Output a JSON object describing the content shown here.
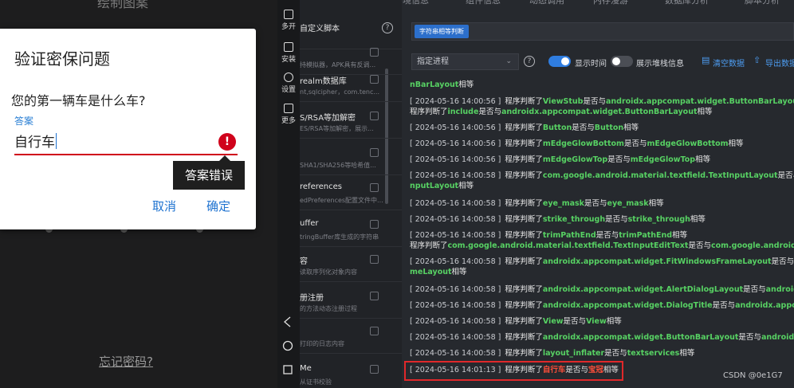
{
  "phone": {
    "top_text": "绘制图案",
    "forgot_password": "忘记密码?",
    "dialog": {
      "title": "验证密保问题",
      "question": "您的第一辆车是什么车?",
      "answer_label": "答案",
      "answer_value": "自行车",
      "error_tooltip": "答案错误",
      "cancel_label": "取消",
      "ok_label": "确定"
    }
  },
  "emulator": {
    "multi_open": "多开",
    "install": "安装",
    "settings": "设置",
    "more": "更多"
  },
  "scripts": {
    "items": [
      {
        "name": "自定义脚本",
        "desc": ""
      },
      {
        "name": "",
        "desc": "持模拟器，APK具有反调..."
      },
      {
        "name": "realm数据库",
        "desc": "nt,sqlcipher，com.tenc..."
      },
      {
        "name": "S/RSA等加解密",
        "desc": "ES/RSA等加解密，展示..."
      },
      {
        "name": "",
        "desc": "SHA1/SHA256等哈希值..."
      },
      {
        "name": "references",
        "desc": "edPreferences配置文件中..."
      },
      {
        "name": "uffer",
        "desc": "tringBuffer库生成的字符串"
      },
      {
        "name": "容",
        "desc": "读取序列化对象内容"
      },
      {
        "name": "册注册",
        "desc": "的方法动态注册过程"
      },
      {
        "name": "",
        "desc": "打印的日志内容"
      },
      {
        "name": "Me",
        "desc": "从证书校验"
      }
    ]
  },
  "logpanel": {
    "top_tabs": [
      "环境信息",
      "组件信息",
      "动态调用",
      "内存漫游",
      "数据库分析",
      "脚本分析"
    ],
    "filter_tag": "字符串相等判断",
    "process_select": "指定进程",
    "show_time_label": "显示时间",
    "show_time_on": true,
    "show_stack_label": "展示堆栈信息",
    "show_stack_on": false,
    "clear_label": "清空数据",
    "export_label": "导出数据",
    "logs": [
      {
        "ts": "",
        "pre": "",
        "a": "nBarLayout",
        "mid": "相等",
        "b": "",
        "post": ""
      },
      {
        "ts": "[ 2024-05-16 14:00:56 ]",
        "pre": "程序判断了",
        "a": "ViewStub",
        "mid": "是否与",
        "b": "androidx.appcompat.widget.ButtonBarLayout",
        "post": "相等"
      },
      {
        "ts": "",
        "pre": "程序判断了",
        "a": "include",
        "mid": "是否与",
        "b": "androidx.appcompat.widget.ButtonBarLayout",
        "post": "相等"
      },
      {
        "ts": "[ 2024-05-16 14:00:56 ]",
        "pre": "程序判断了",
        "a": "Button",
        "mid": "是否与",
        "b": "Button",
        "post": "相等"
      },
      {
        "ts": "[ 2024-05-16 14:00:56 ]",
        "pre": "程序判断了",
        "a": "mEdgeGlowBottom",
        "mid": "是否与",
        "b": "mEdgeGlowBottom",
        "post": "相等"
      },
      {
        "ts": "[ 2024-05-16 14:00:56 ]",
        "pre": "程序判断了",
        "a": "mEdgeGlowTop",
        "mid": "是否与",
        "b": "mEdgeGlowTop",
        "post": "相等"
      },
      {
        "ts": "[ 2024-05-16 14:00:58 ]",
        "pre": "程序判断了",
        "a": "com.google.android.material.textfield.TextInputLayout",
        "mid": "是否与",
        "b": "com.",
        "post": ""
      },
      {
        "ts": "",
        "pre": "",
        "a": "nputLayout",
        "mid": "相等",
        "b": "",
        "post": ""
      },
      {
        "ts": "[ 2024-05-16 14:00:58 ]",
        "pre": "程序判断了",
        "a": "eye_mask",
        "mid": "是否与",
        "b": "eye_mask",
        "post": "相等"
      },
      {
        "ts": "[ 2024-05-16 14:00:58 ]",
        "pre": "程序判断了",
        "a": "strike_through",
        "mid": "是否与",
        "b": "strike_through",
        "post": "相等"
      },
      {
        "ts": "[ 2024-05-16 14:00:58 ]",
        "pre": "程序判断了",
        "a": "trimPathEnd",
        "mid": "是否与",
        "b": "trimPathEnd",
        "post": "相等"
      },
      {
        "ts": "",
        "pre": "程序判断了",
        "a": "com.google.android.material.textfield.TextInputEditText",
        "mid": "是否与",
        "b": "com.google.android.mater",
        "post": ""
      },
      {
        "ts": "[ 2024-05-16 14:00:58 ]",
        "pre": "程序判断了",
        "a": "androidx.appcompat.widget.FitWindowsFrameLayout",
        "mid": "是否与",
        "b": "androi",
        "post": ""
      },
      {
        "ts": "",
        "pre": "",
        "a": "meLayout",
        "mid": "相等",
        "b": "",
        "post": ""
      },
      {
        "ts": "[ 2024-05-16 14:00:58 ]",
        "pre": "程序判断了",
        "a": "androidx.appcompat.widget.AlertDialogLayout",
        "mid": "是否与",
        "b": "androidx.app",
        "post": ""
      },
      {
        "ts": "[ 2024-05-16 14:00:58 ]",
        "pre": "程序判断了",
        "a": "androidx.appcompat.widget.DialogTitle",
        "mid": "是否与",
        "b": "androidx.appcompa",
        "post": ""
      },
      {
        "ts": "[ 2024-05-16 14:00:58 ]",
        "pre": "程序判断了",
        "a": "View",
        "mid": "是否与",
        "b": "View",
        "post": "相等"
      },
      {
        "ts": "[ 2024-05-16 14:00:58 ]",
        "pre": "程序判断了",
        "a": "androidx.appcompat.widget.ButtonBarLayout",
        "mid": "是否与",
        "b": "androidx.appc",
        "post": ""
      },
      {
        "ts": "[ 2024-05-16 14:00:58 ]",
        "pre": "程序判断了",
        "a": "layout_inflater",
        "mid": "是否与",
        "b": "textservices",
        "post": "相等"
      },
      {
        "ts": "[ 2024-05-16 14:01:13 ]",
        "pre": "程序判断了",
        "a": "自行车",
        "mid": "是否与",
        "b": "宝冠",
        "post": "相等"
      }
    ],
    "watermark": "CSDN @0e1G7"
  },
  "colors": {
    "accent_blue": "#2c6fcb",
    "log_green": "#57d163",
    "error_red": "#d0021b"
  }
}
